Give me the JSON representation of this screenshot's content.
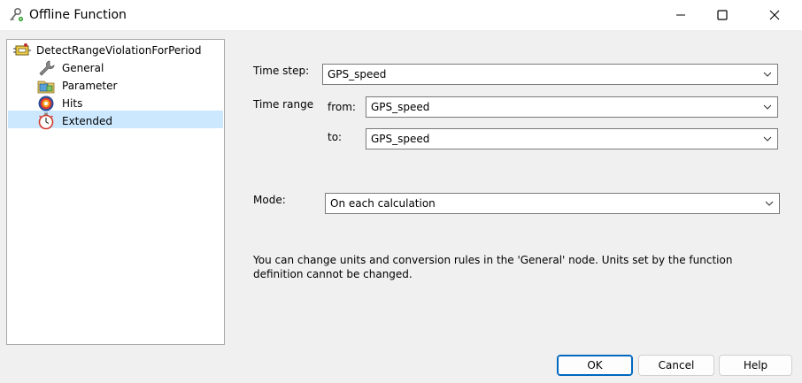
{
  "window": {
    "title": "Offline Function",
    "icon": "key-settings-icon"
  },
  "tree": {
    "root": {
      "label": "DetectRangeViolationForPeriod",
      "icon": "function-block-icon"
    },
    "items": [
      {
        "label": "General",
        "icon": "wrench-icon"
      },
      {
        "label": "Parameter",
        "icon": "parameter-icon"
      },
      {
        "label": "Hits",
        "icon": "target-icon"
      },
      {
        "label": "Extended",
        "icon": "stopwatch-icon",
        "selected": true
      }
    ]
  },
  "form": {
    "time_step_label": "Time step:",
    "time_step_value": "GPS_speed",
    "time_range_label": "Time range",
    "from_label": "from:",
    "from_value": "GPS_speed",
    "to_label": "to:",
    "to_value": "GPS_speed",
    "mode_label": "Mode:",
    "mode_value": "On each calculation"
  },
  "info_text": "You can change units and conversion rules in the 'General' node. Units set by the function definition cannot be changed.",
  "buttons": {
    "ok": "OK",
    "cancel": "Cancel",
    "help": "Help"
  },
  "colors": {
    "selection": "#cce8ff",
    "focus_border": "#0067c0",
    "window_bg": "#f0f0f0"
  }
}
